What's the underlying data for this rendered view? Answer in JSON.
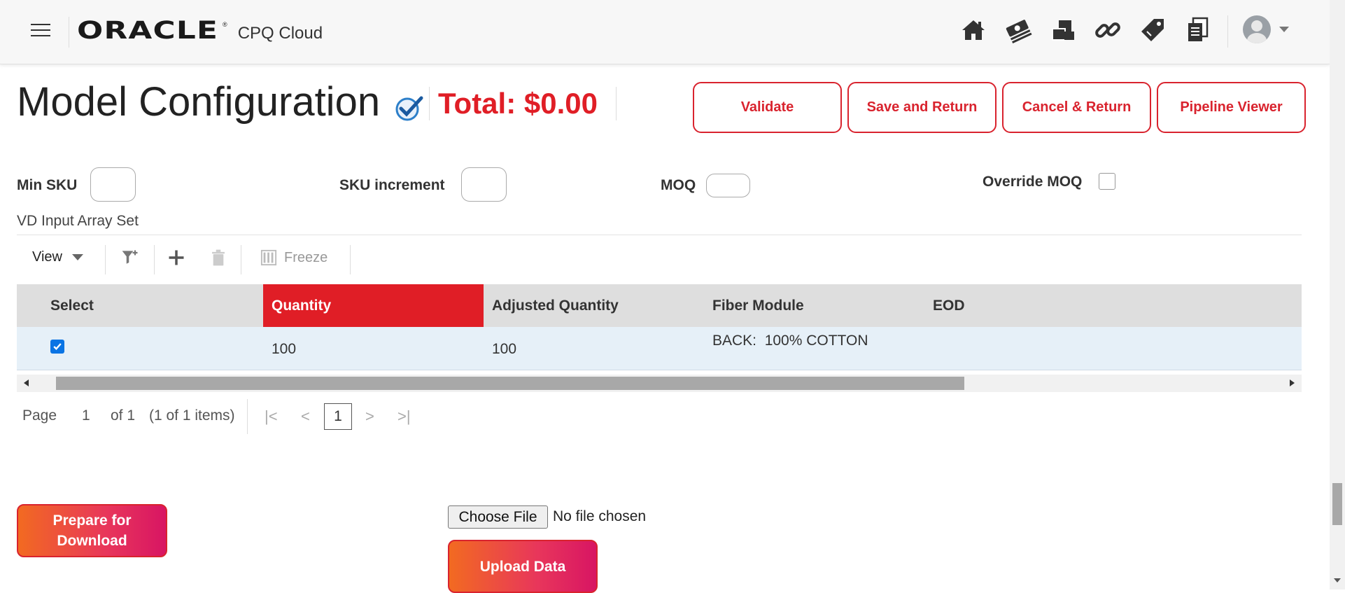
{
  "header": {
    "logo_text": "ORACLE",
    "logo_mark": "®",
    "product": "CPQ Cloud",
    "icons": [
      "home-icon",
      "money-icon",
      "cubes-icon",
      "link-icon",
      "tag-icon",
      "documents-icon"
    ]
  },
  "page": {
    "title": "Model Configuration",
    "total": "Total: $0.00"
  },
  "actions": {
    "validate": "Validate",
    "save_return": "Save and Return",
    "cancel_return": "Cancel & Return",
    "pipeline_viewer": "Pipeline Viewer"
  },
  "fields": {
    "min_sku": {
      "label": "Min SKU",
      "value": ""
    },
    "sku_increment": {
      "label": "SKU increment",
      "value": ""
    },
    "moq": {
      "label": "MOQ",
      "value": ""
    },
    "override_moq": {
      "label": "Override MOQ",
      "checked": false
    }
  },
  "array_set": {
    "title": "VD Input Array Set",
    "toolbar": {
      "view_label": "View",
      "freeze_label": "Freeze"
    },
    "columns": [
      "Select",
      "Quantity",
      "Adjusted Quantity",
      "Fiber Module",
      "EOD"
    ],
    "rows": [
      {
        "select": true,
        "quantity": "100",
        "adjusted_quantity": "100",
        "fiber_module": "BACK:  100% COTTON",
        "eod": ""
      }
    ],
    "pager": {
      "page_label": "Page",
      "page_value": "1",
      "of_label": "of 1",
      "items_label": "(1 of 1 items)",
      "current_page": "1"
    }
  },
  "bottom": {
    "prepare_download": "Prepare for Download",
    "choose_file": "Choose File",
    "file_status": "No file chosen",
    "upload_data": "Upload Data"
  },
  "colors": {
    "accent_red": "#e01e26",
    "gradient_start": "#f26a21",
    "gradient_end": "#d81563",
    "row_bg": "#e6f0f8"
  }
}
